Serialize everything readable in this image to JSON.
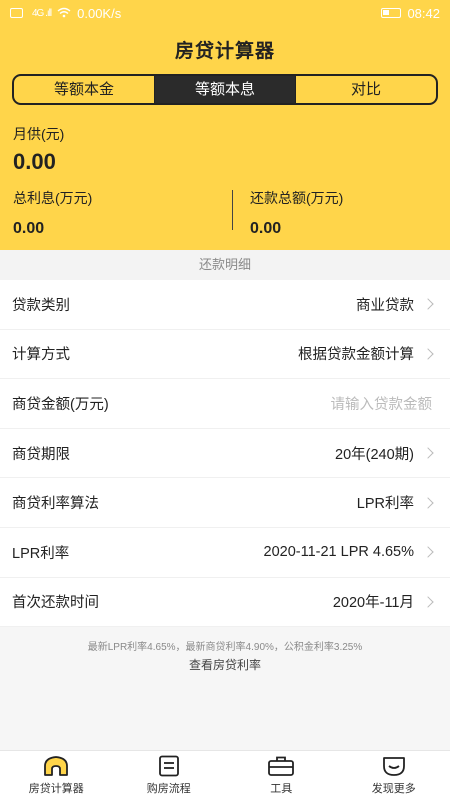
{
  "status_bar": {
    "speed": "0.00K/s",
    "time": "08:42",
    "signal": "4G .ıll"
  },
  "header": {
    "title": "房贷计算器"
  },
  "segments": [
    {
      "label": "等额本金",
      "active": false
    },
    {
      "label": "等额本息",
      "active": true
    },
    {
      "label": "对比",
      "active": false
    }
  ],
  "summary": {
    "monthly_label": "月供(元)",
    "monthly_value": "0.00",
    "interest_label": "总利息(万元)",
    "interest_value": "0.00",
    "total_label": "还款总额(万元)",
    "total_value": "0.00"
  },
  "section_title": "还款明细",
  "rows": [
    {
      "name": "贷款类别",
      "value": "商业贷款"
    },
    {
      "name": "计算方式",
      "value": "根据贷款金额计算"
    },
    {
      "name": "商贷金额(万元)",
      "value": "",
      "placeholder": "请输入贷款金额"
    },
    {
      "name": "商贷期限",
      "value": "20年(240期)"
    },
    {
      "name": "商贷利率算法",
      "value": "LPR利率"
    },
    {
      "name": "LPR利率",
      "value": "2020-11-21 LPR 4.65%"
    },
    {
      "name": "首次还款时间",
      "value": "2020年-11月"
    }
  ],
  "footer": {
    "note": "最新LPR利率4.65%，最新商贷利率4.90%，公积金利率3.25%",
    "link": "查看房贷利率"
  },
  "tabbar": [
    {
      "label": "房贷计算器",
      "icon": "home-icon",
      "active": true
    },
    {
      "label": "购房流程",
      "icon": "document-icon",
      "active": false
    },
    {
      "label": "工具",
      "icon": "briefcase-icon",
      "active": false
    },
    {
      "label": "发现更多",
      "icon": "discover-icon",
      "active": false
    }
  ],
  "colors": {
    "accent": "#ffd54a",
    "dark": "#2b2b2b"
  }
}
